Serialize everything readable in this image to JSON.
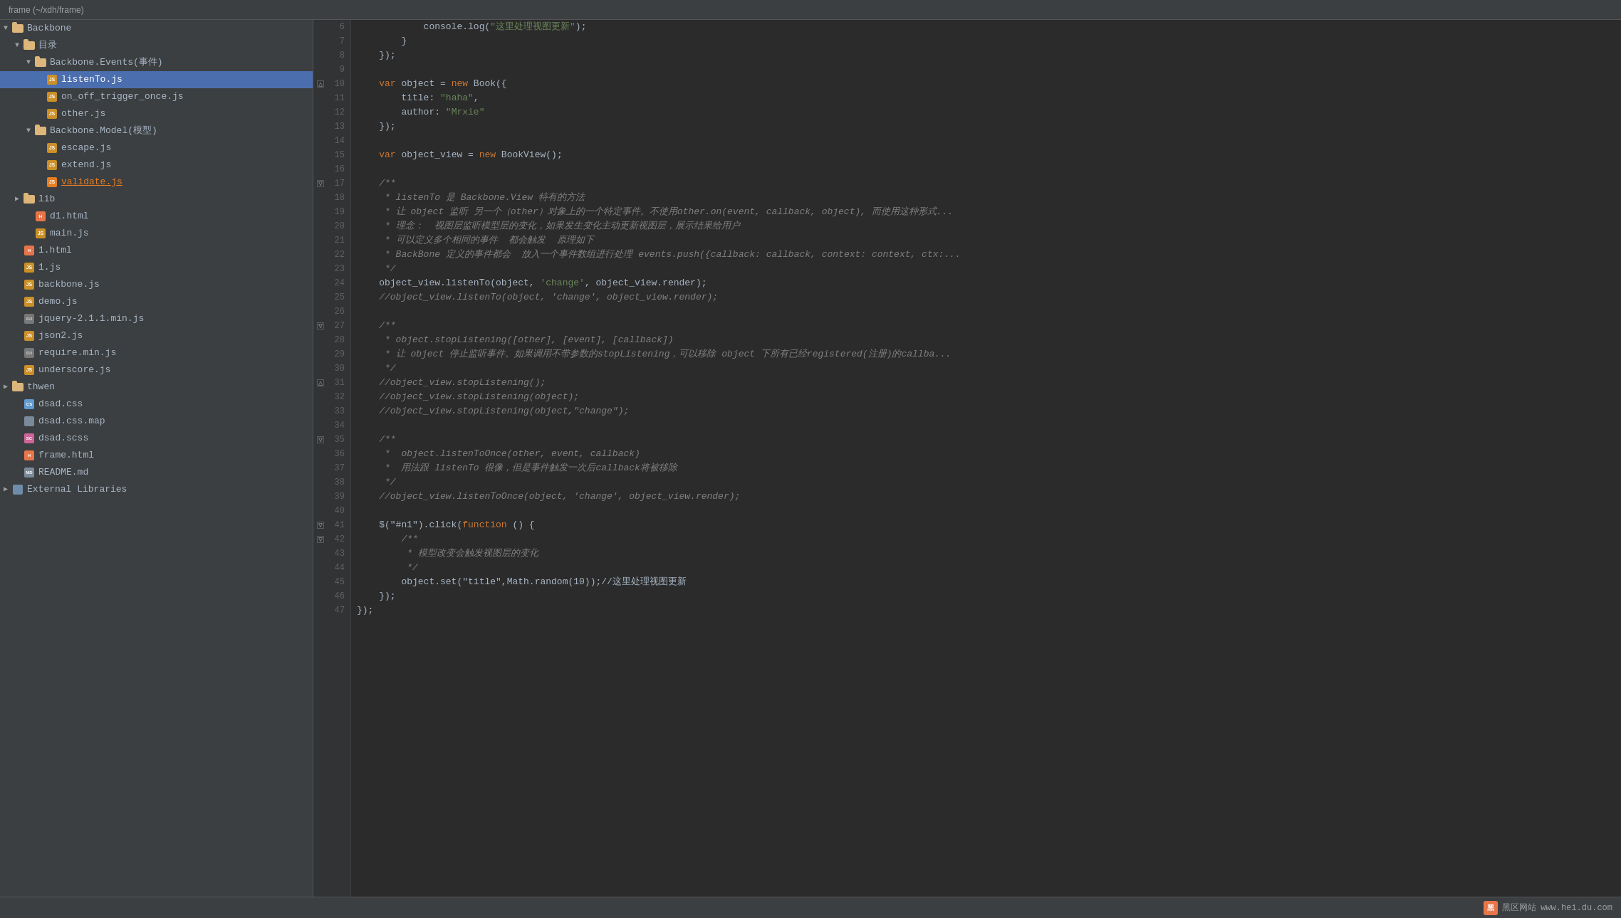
{
  "titleBar": {
    "text": "frame (~/xdh/frame)"
  },
  "sidebar": {
    "rootLabel": "frame",
    "items": [
      {
        "id": "backbone",
        "label": "Backbone",
        "type": "folder",
        "level": 0,
        "expanded": true,
        "arrow": "▼"
      },
      {
        "id": "mulu",
        "label": "目录",
        "type": "folder",
        "level": 1,
        "expanded": true,
        "arrow": "▼"
      },
      {
        "id": "backbone-events",
        "label": "Backbone.Events(事件)",
        "type": "folder",
        "level": 2,
        "expanded": true,
        "arrow": "▼"
      },
      {
        "id": "listento",
        "label": "listenTo.js",
        "type": "js",
        "level": 3,
        "selected": true
      },
      {
        "id": "onoff",
        "label": "on_off_trigger_once.js",
        "type": "js",
        "level": 3
      },
      {
        "id": "other",
        "label": "other.js",
        "type": "js",
        "level": 3
      },
      {
        "id": "backbone-model",
        "label": "Backbone.Model(模型)",
        "type": "folder",
        "level": 2,
        "expanded": true,
        "arrow": "▼"
      },
      {
        "id": "escape",
        "label": "escape.js",
        "type": "js",
        "level": 3
      },
      {
        "id": "extend",
        "label": "extend.js",
        "type": "js",
        "level": 3
      },
      {
        "id": "validate",
        "label": "validate.js",
        "type": "js",
        "level": 3,
        "warning": true
      },
      {
        "id": "lib",
        "label": "lib",
        "type": "folder",
        "level": 1,
        "expanded": false,
        "arrow": "▶"
      },
      {
        "id": "d1html",
        "label": "d1.html",
        "type": "html",
        "level": 2
      },
      {
        "id": "mainjs",
        "label": "main.js",
        "type": "js",
        "level": 2
      },
      {
        "id": "1html",
        "label": "1.html",
        "type": "html",
        "level": 1
      },
      {
        "id": "1js",
        "label": "1.js",
        "type": "js",
        "level": 1
      },
      {
        "id": "backbonejs",
        "label": "backbone.js",
        "type": "js",
        "level": 1
      },
      {
        "id": "demojs",
        "label": "demo.js",
        "type": "js",
        "level": 1
      },
      {
        "id": "jquerymin",
        "label": "jquery-2.1.1.min.js",
        "type": "minjs",
        "level": 1
      },
      {
        "id": "json2",
        "label": "json2.js",
        "type": "js",
        "level": 1
      },
      {
        "id": "requiremin",
        "label": "require.min.js",
        "type": "minjs",
        "level": 1
      },
      {
        "id": "underscore",
        "label": "underscore.js",
        "type": "js",
        "level": 1
      },
      {
        "id": "thwen",
        "label": "thwen",
        "type": "folder",
        "level": 0,
        "expanded": false,
        "arrow": "▶"
      },
      {
        "id": "dsadcss",
        "label": "dsad.css",
        "type": "css",
        "level": 1
      },
      {
        "id": "dsadcssmap",
        "label": "dsad.css.map",
        "type": "file",
        "level": 1
      },
      {
        "id": "dsadscss",
        "label": "dsad.scss",
        "type": "scss",
        "level": 1
      },
      {
        "id": "framehtml",
        "label": "frame.html",
        "type": "html",
        "level": 1
      },
      {
        "id": "readmemd",
        "label": "README.md",
        "type": "md",
        "level": 1
      },
      {
        "id": "extlib",
        "label": "External Libraries",
        "type": "extlib",
        "level": 0,
        "expanded": false,
        "arrow": "▶"
      }
    ]
  },
  "editor": {
    "lines": [
      {
        "num": 6,
        "fold": null,
        "content": [
          {
            "t": "            console.log(",
            "c": "plain"
          },
          {
            "t": "\"这里处理视图更新\"",
            "c": "str"
          },
          {
            "t": ");",
            "c": "plain"
          }
        ]
      },
      {
        "num": 7,
        "fold": null,
        "content": [
          {
            "t": "        }",
            "c": "plain"
          }
        ]
      },
      {
        "num": 8,
        "fold": null,
        "content": [
          {
            "t": "    });",
            "c": "plain"
          }
        ]
      },
      {
        "num": 9,
        "fold": null,
        "content": []
      },
      {
        "num": 10,
        "fold": "close",
        "content": [
          {
            "t": "    ",
            "c": "plain"
          },
          {
            "t": "var",
            "c": "kw"
          },
          {
            "t": " object = ",
            "c": "plain"
          },
          {
            "t": "new",
            "c": "kw"
          },
          {
            "t": " Book({",
            "c": "plain"
          }
        ]
      },
      {
        "num": 11,
        "fold": null,
        "content": [
          {
            "t": "        title: ",
            "c": "plain"
          },
          {
            "t": "\"haha\"",
            "c": "str"
          },
          {
            "t": ",",
            "c": "plain"
          }
        ]
      },
      {
        "num": 12,
        "fold": null,
        "content": [
          {
            "t": "        author: ",
            "c": "plain"
          },
          {
            "t": "\"Mrxie\"",
            "c": "str"
          }
        ]
      },
      {
        "num": 13,
        "fold": null,
        "content": [
          {
            "t": "    });",
            "c": "plain"
          }
        ]
      },
      {
        "num": 14,
        "fold": null,
        "content": []
      },
      {
        "num": 15,
        "fold": null,
        "content": [
          {
            "t": "    ",
            "c": "plain"
          },
          {
            "t": "var",
            "c": "kw"
          },
          {
            "t": " object_view = ",
            "c": "plain"
          },
          {
            "t": "new",
            "c": "kw"
          },
          {
            "t": " BookView();",
            "c": "plain"
          }
        ]
      },
      {
        "num": 16,
        "fold": null,
        "content": []
      },
      {
        "num": 17,
        "fold": "open",
        "content": [
          {
            "t": "    /**",
            "c": "comment"
          }
        ]
      },
      {
        "num": 18,
        "fold": null,
        "content": [
          {
            "t": "     * ",
            "c": "comment"
          },
          {
            "t": "listenTo",
            "c": "italic-comment"
          },
          {
            "t": " 是 ",
            "c": "comment"
          },
          {
            "t": "Backbone.View",
            "c": "italic-comment"
          },
          {
            "t": " 特有的方法",
            "c": "comment"
          }
        ]
      },
      {
        "num": 19,
        "fold": null,
        "content": [
          {
            "t": "     * 让 object 监听 另一个（other）对象上的一个特定事件。不使用other.on(event, callback, object), 而使用这种形式...",
            "c": "comment"
          }
        ]
      },
      {
        "num": 20,
        "fold": null,
        "content": [
          {
            "t": "     * 理念：  视图层监听模型层的变化，如果发生变化主动更新视图层，展示结果给用户",
            "c": "comment"
          }
        ]
      },
      {
        "num": 21,
        "fold": null,
        "content": [
          {
            "t": "     * 可以定义多个相同的事件  都会触发  原理如下",
            "c": "comment"
          }
        ]
      },
      {
        "num": 22,
        "fold": null,
        "content": [
          {
            "t": "     * ",
            "c": "comment"
          },
          {
            "t": "BackBone",
            "c": "italic-comment"
          },
          {
            "t": " 定义的事件都会  放入一个事件数组进行处理 events.push({callback: callback, context: context, ctx:...",
            "c": "comment"
          }
        ]
      },
      {
        "num": 23,
        "fold": null,
        "content": [
          {
            "t": "     */",
            "c": "comment"
          }
        ]
      },
      {
        "num": 24,
        "fold": null,
        "content": [
          {
            "t": "    object_view.listenTo(object, ",
            "c": "plain"
          },
          {
            "t": "'change'",
            "c": "str"
          },
          {
            "t": ", object_view.render);",
            "c": "plain"
          }
        ]
      },
      {
        "num": 25,
        "fold": null,
        "content": [
          {
            "t": "    //object_view.listenTo(object, 'change', object_view.render);",
            "c": "comment"
          }
        ]
      },
      {
        "num": 26,
        "fold": null,
        "content": []
      },
      {
        "num": 27,
        "fold": "open",
        "content": [
          {
            "t": "    /**",
            "c": "comment"
          }
        ]
      },
      {
        "num": 28,
        "fold": null,
        "content": [
          {
            "t": "     * object.stopListening([other], [event], [callback])",
            "c": "comment"
          }
        ]
      },
      {
        "num": 29,
        "fold": null,
        "content": [
          {
            "t": "     * 让 object 停止监听事件。如果调用不带参数的stopListening，可以移除 object 下所有已经registered(注册)的callba...",
            "c": "comment"
          }
        ]
      },
      {
        "num": 30,
        "fold": null,
        "content": [
          {
            "t": "     */",
            "c": "comment"
          }
        ]
      },
      {
        "num": 31,
        "fold": "close",
        "content": [
          {
            "t": "    //object_view.stopListening();",
            "c": "comment"
          }
        ]
      },
      {
        "num": 32,
        "fold": null,
        "content": [
          {
            "t": "    //object_view.stopListening(object);",
            "c": "comment"
          }
        ]
      },
      {
        "num": 33,
        "fold": null,
        "content": [
          {
            "t": "    //object_view.stopListening(object,\"change\");",
            "c": "comment"
          }
        ]
      },
      {
        "num": 34,
        "fold": null,
        "content": []
      },
      {
        "num": 35,
        "fold": "open",
        "content": [
          {
            "t": "    /**",
            "c": "comment"
          }
        ]
      },
      {
        "num": 36,
        "fold": null,
        "content": [
          {
            "t": "     *  object.listenToOnce(other, event, callback)",
            "c": "comment"
          }
        ]
      },
      {
        "num": 37,
        "fold": null,
        "content": [
          {
            "t": "     *  用法跟 listenTo 很像，但是事件触发一次后callback将被移除",
            "c": "comment"
          }
        ]
      },
      {
        "num": 38,
        "fold": null,
        "content": [
          {
            "t": "     */",
            "c": "comment"
          }
        ]
      },
      {
        "num": 39,
        "fold": null,
        "content": [
          {
            "t": "    //object_view.listenToOnce(object, 'change', object_view.render);",
            "c": "comment"
          }
        ]
      },
      {
        "num": 40,
        "fold": null,
        "content": []
      },
      {
        "num": 41,
        "fold": "open",
        "content": [
          {
            "t": "    $(\"#n1\").click(",
            "c": "plain"
          },
          {
            "t": "function",
            "c": "kw"
          },
          {
            "t": " () {",
            "c": "plain"
          }
        ]
      },
      {
        "num": 42,
        "fold": "open",
        "content": [
          {
            "t": "        /**",
            "c": "comment"
          }
        ]
      },
      {
        "num": 43,
        "fold": null,
        "content": [
          {
            "t": "         * 模型改变会触发视图层的变化",
            "c": "comment"
          }
        ]
      },
      {
        "num": 44,
        "fold": null,
        "content": [
          {
            "t": "         */",
            "c": "comment"
          }
        ]
      },
      {
        "num": 45,
        "fold": null,
        "content": [
          {
            "t": "        object.set(\"title\",Math.random(10));//这里处理视图更新",
            "c": "plain"
          }
        ]
      },
      {
        "num": 46,
        "fold": null,
        "content": [
          {
            "t": "    });",
            "c": "plain"
          }
        ]
      },
      {
        "num": 47,
        "fold": null,
        "content": [
          {
            "t": "});",
            "c": "plain"
          }
        ]
      }
    ]
  },
  "bottomBar": {
    "logoText": "黑区网站",
    "logoUrl": "www.hei.du.com"
  }
}
